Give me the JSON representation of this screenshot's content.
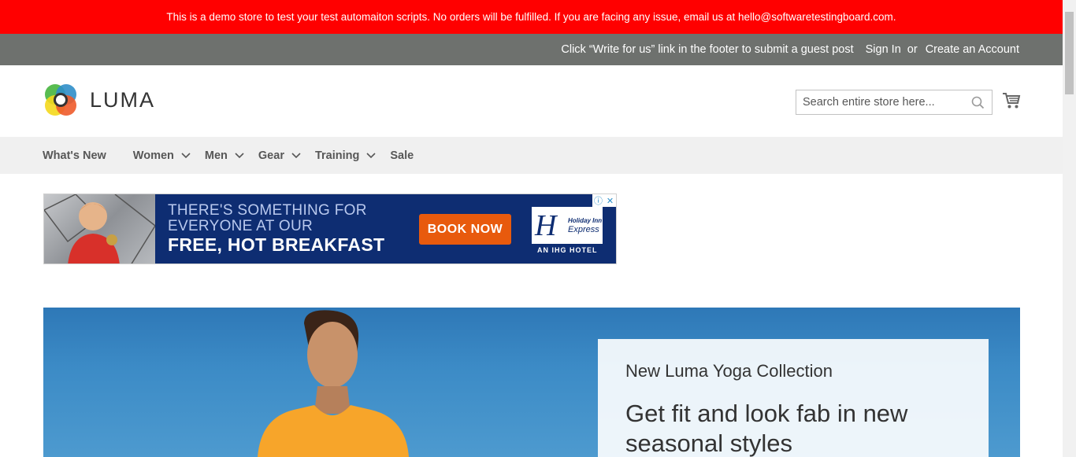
{
  "demo_banner": {
    "text": "This is a demo store to test your test automaiton scripts. No orders will be fulfilled. If you are facing any issue, email us at hello@softwaretestingboard.com."
  },
  "panel_header": {
    "guest_post_text": "Click “Write for us” link in the footer to submit a guest post",
    "sign_in": "Sign In",
    "or": "or",
    "create_account": "Create an Account"
  },
  "header": {
    "logo_text": "LUMA",
    "search_placeholder": "Search entire store here...",
    "search_icon": "search-icon",
    "cart_icon": "cart-icon"
  },
  "nav": {
    "items": [
      {
        "label": "What's New",
        "has_sub": false
      },
      {
        "label": "Women",
        "has_sub": true
      },
      {
        "label": "Men",
        "has_sub": true
      },
      {
        "label": "Gear",
        "has_sub": true
      },
      {
        "label": "Training",
        "has_sub": true
      },
      {
        "label": "Sale",
        "has_sub": false
      }
    ]
  },
  "ad": {
    "line1": "THERE'S SOMETHING FOR",
    "line2": "EVERYONE AT OUR",
    "line3": "FREE, HOT BREAKFAST",
    "button": "BOOK NOW",
    "brand_small1": "Holiday Inn",
    "brand_small2": "Express",
    "tagline": "AN IHG HOTEL",
    "info_icon": "info-icon",
    "close_icon": "close-icon"
  },
  "hero": {
    "subtitle": "New Luma Yoga Collection",
    "headline": "Get fit and look fab in new seasonal styles"
  },
  "colors": {
    "banner": "#ff0000",
    "panel": "#6e716e",
    "nav_bg": "#f0f0f0",
    "ad_bg": "#0e2d72",
    "ad_button": "#e85a0d",
    "hero_bg": "#3c8bc6"
  }
}
